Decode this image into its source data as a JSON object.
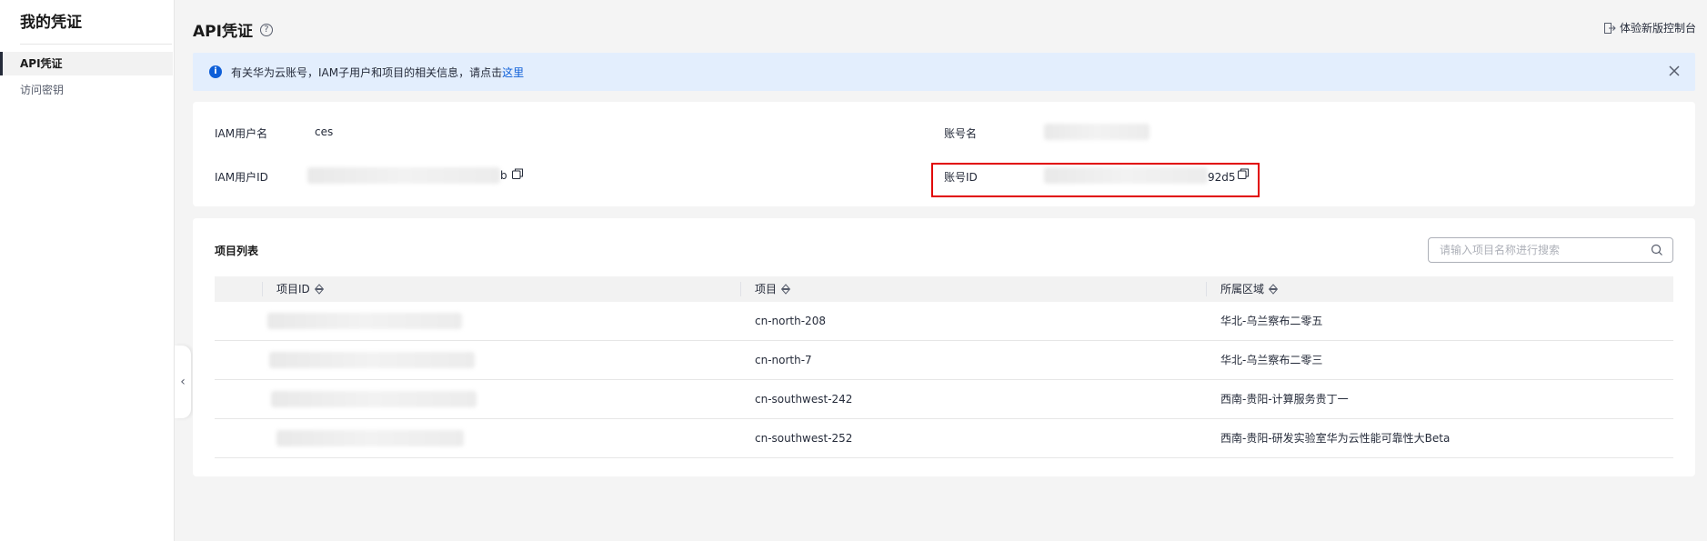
{
  "sidebar": {
    "title": "我的凭证",
    "items": [
      {
        "label": "API凭证",
        "active": true
      },
      {
        "label": "访问密钥",
        "active": false
      }
    ]
  },
  "header": {
    "title": "API凭证",
    "help_icon": "question-circle-icon",
    "new_console": "体验新版控制台",
    "new_console_icon": "exit-icon"
  },
  "info": {
    "text": "有关华为云账号，IAM子用户和项目的相关信息，请点击",
    "link": "这里"
  },
  "account": {
    "iam_user_label": "IAM用户名",
    "iam_user_value": "ces",
    "iam_id_label": "IAM用户ID",
    "iam_id_suffix": "b",
    "account_name_label": "账号名",
    "account_id_label": "账号ID",
    "account_id_suffix": "92d5"
  },
  "projects": {
    "title": "项目列表",
    "search_placeholder": "请输入项目名称进行搜索",
    "columns": [
      "项目ID",
      "项目",
      "所属区域"
    ],
    "rows": [
      {
        "project": "cn-north-208",
        "region": "华北-乌兰察布二零五"
      },
      {
        "project": "cn-north-7",
        "region": "华北-乌兰察布二零三"
      },
      {
        "project": "cn-southwest-242",
        "region": "西南-贵阳-计算服务贵丁一"
      },
      {
        "project": "cn-southwest-252",
        "region": "西南-贵阳-研发实验室华为云性能可靠性大Beta"
      }
    ]
  },
  "colors": {
    "accent": "#0e5fd8",
    "info_bg": "#e3eefd",
    "highlight": "#e10000"
  }
}
